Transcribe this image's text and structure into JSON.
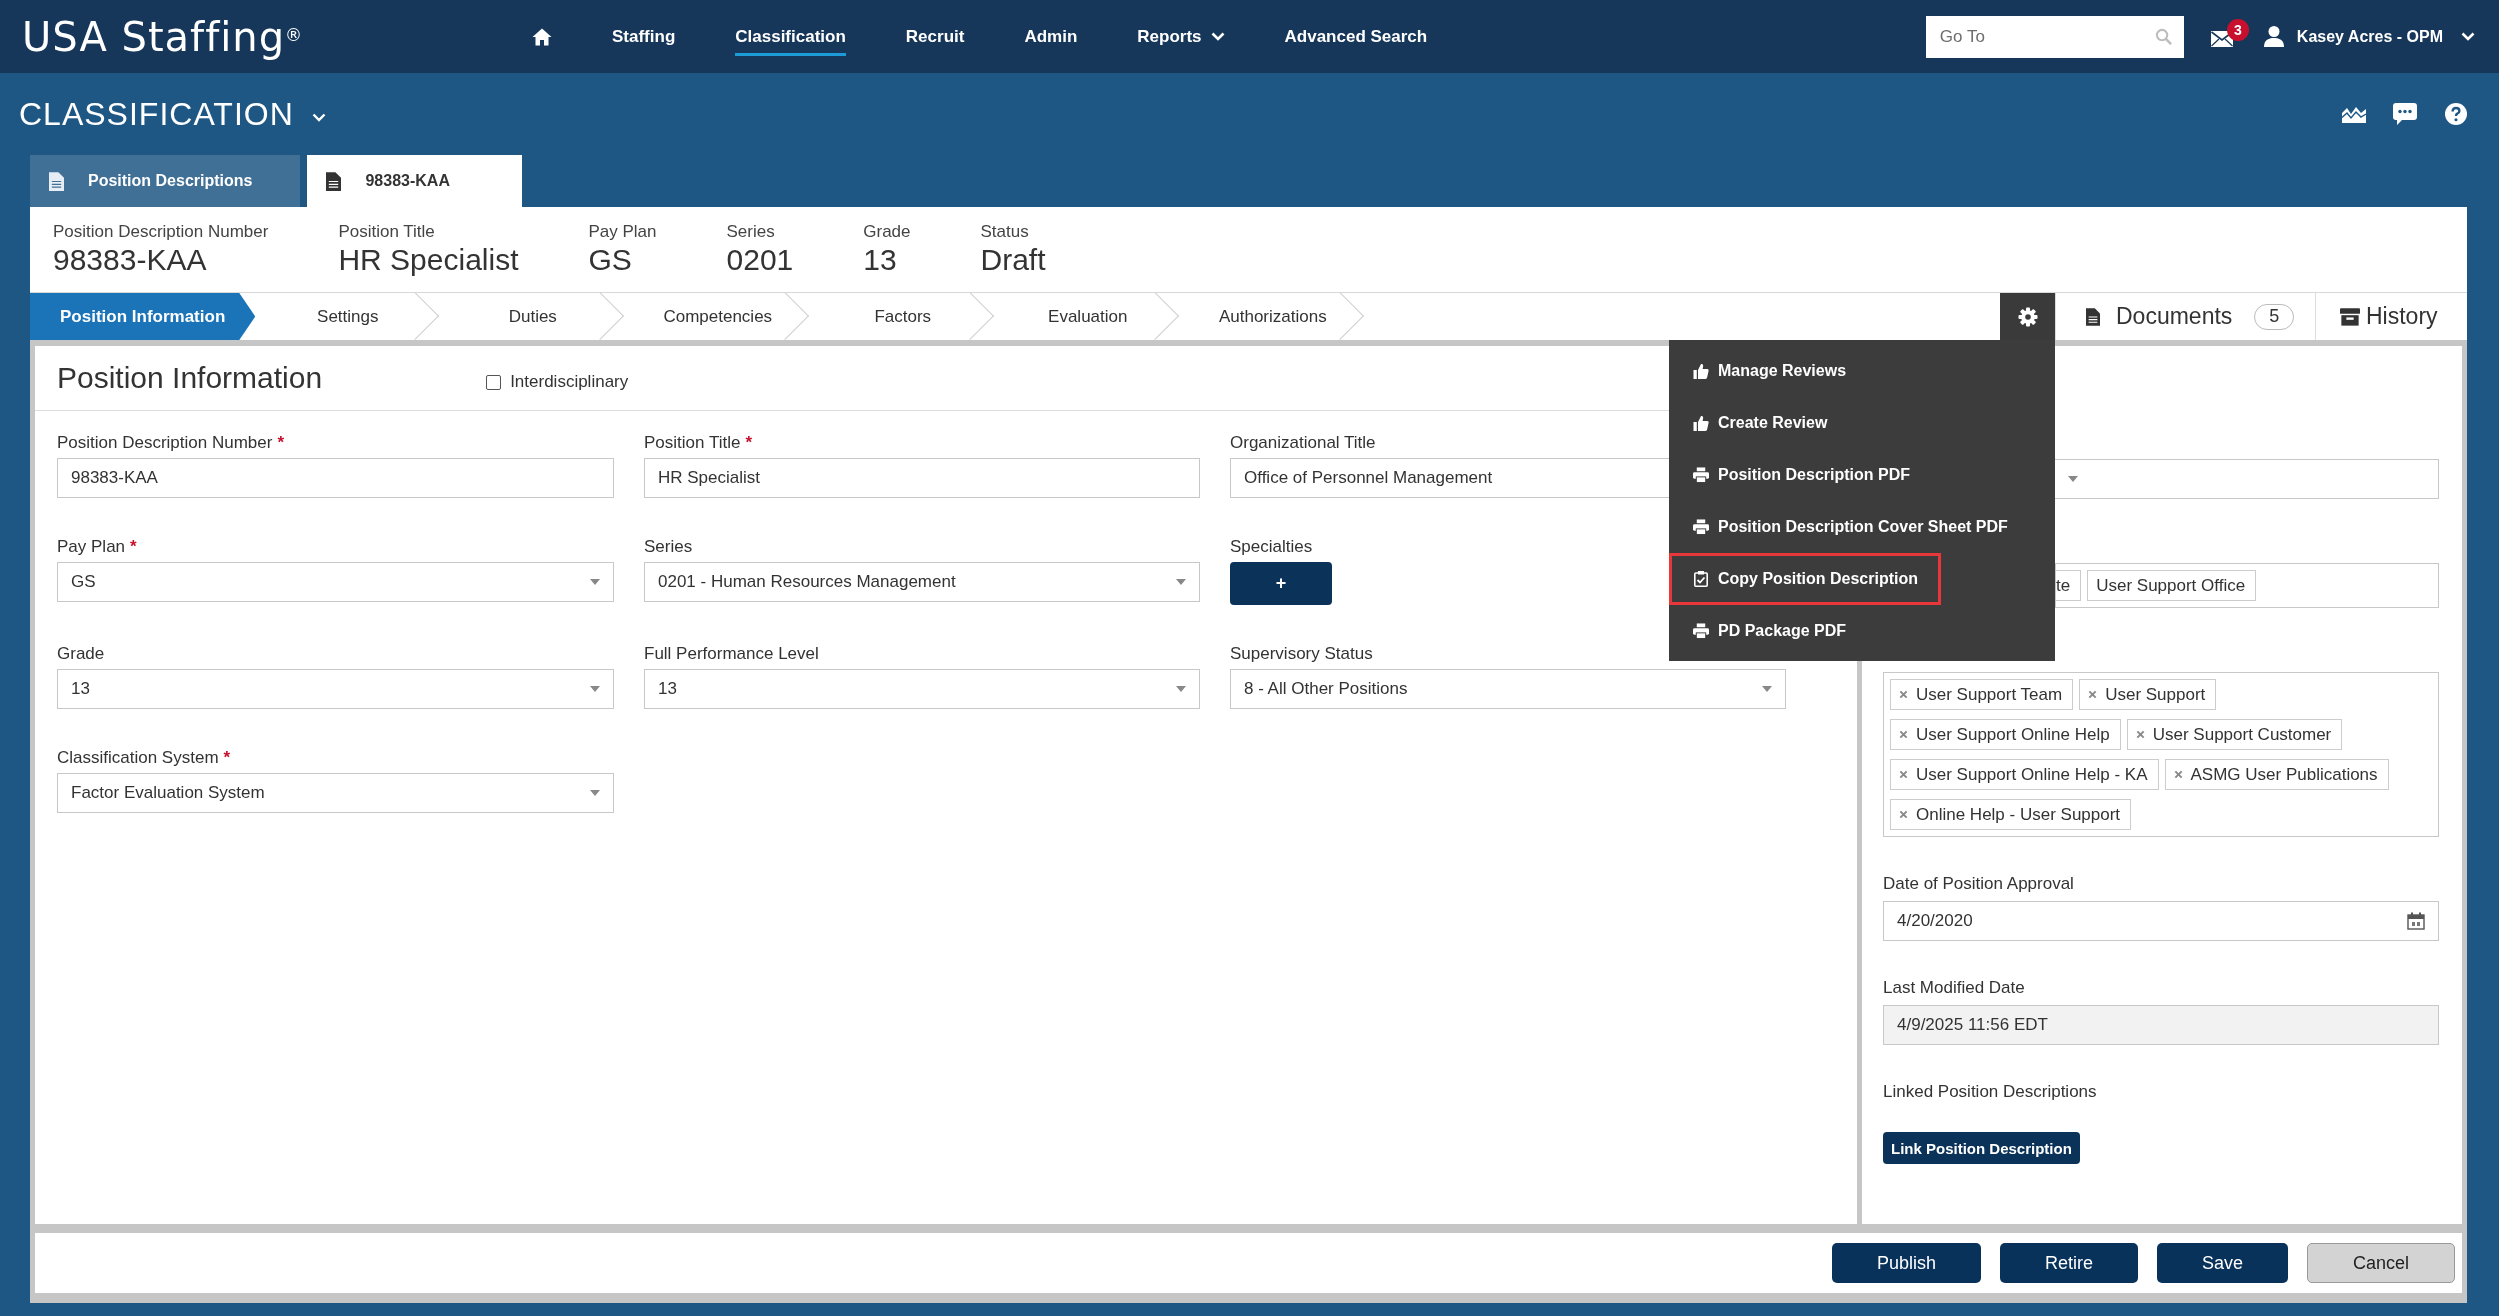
{
  "header": {
    "logo": "USA Staffing$^{®}$",
    "nav": [
      {
        "label": "Staffing",
        "selected": false,
        "dropdown": false
      },
      {
        "label": "Classification",
        "selected": true,
        "dropdown": false
      },
      {
        "label": "Recruit",
        "selected": false,
        "dropdown": false
      },
      {
        "label": "Admin",
        "selected": false,
        "dropdown": false
      },
      {
        "label": "Reports",
        "selected": false,
        "dropdown": true
      },
      {
        "label": "Advanced Search",
        "selected": false,
        "dropdown": false
      }
    ],
    "goto": {
      "placeholder": "Go To"
    },
    "messages": {
      "badge": "3"
    },
    "user": {
      "name": "Kasey Acres - OPM"
    }
  },
  "module": {
    "title": "CLASSIFICATION"
  },
  "tabs": [
    {
      "label": "Position Descriptions",
      "selected": false
    },
    {
      "label": "98383-KAA",
      "selected": true
    }
  ],
  "summary": [
    {
      "label": "Position Description Number",
      "value": "98383-KAA"
    },
    {
      "label": "Position Title",
      "value": "HR Specialist"
    },
    {
      "label": "Pay Plan",
      "value": "GS"
    },
    {
      "label": "Series",
      "value": "0201"
    },
    {
      "label": "Grade",
      "value": "13"
    },
    {
      "label": "Status",
      "value": "Draft"
    }
  ],
  "steps": [
    {
      "label": "Position Information",
      "selected": true
    },
    {
      "label": "Settings",
      "selected": false
    },
    {
      "label": "Duties",
      "selected": false
    },
    {
      "label": "Competencies",
      "selected": false
    },
    {
      "label": "Factors",
      "selected": false
    },
    {
      "label": "Evaluation",
      "selected": false
    },
    {
      "label": "Authorizations",
      "selected": false
    }
  ],
  "side_tabs": {
    "documents": {
      "label": "Documents",
      "count": "5"
    },
    "history": {
      "label": "History"
    }
  },
  "actions_menu": {
    "expanded": true,
    "items": [
      {
        "label": "Manage Reviews",
        "kind": "review",
        "highlighted": false
      },
      {
        "label": "Create Review",
        "kind": "review",
        "highlighted": false
      },
      {
        "label": "Position Description PDF",
        "kind": "print",
        "highlighted": false
      },
      {
        "label": "Position Description Cover Sheet PDF",
        "kind": "print",
        "highlighted": false
      },
      {
        "label": "Copy Position Description",
        "kind": "copy",
        "highlighted": true
      },
      {
        "label": "PD Package PDF",
        "kind": "print",
        "highlighted": false
      }
    ]
  },
  "section": {
    "title": "Position Information",
    "interdisciplinary": {
      "label": "Interdisciplinary",
      "checked": false
    }
  },
  "form": {
    "required_mark": "*",
    "fields": [
      {
        "label": "Position Description Number",
        "required": true,
        "kind": "text",
        "value": "98383-KAA",
        "covered": false
      },
      {
        "label": "Position Title",
        "required": true,
        "kind": "text",
        "value": "HR Specialist",
        "covered": false
      },
      {
        "label": "Organizational Title",
        "required": false,
        "kind": "text",
        "value": "Office of Personnel Management",
        "covered": true
      },
      {
        "label": "Pay Plan",
        "required": true,
        "kind": "select",
        "value": "GS",
        "covered": false
      },
      {
        "label": "Series",
        "required": false,
        "kind": "select",
        "value": "0201 - Human Resources Management",
        "covered": false
      },
      {
        "label": "Specialties",
        "required": false,
        "kind": "add",
        "button": "+",
        "covered": false
      },
      {
        "label": "Grade",
        "required": false,
        "kind": "select",
        "value": "13",
        "covered": false
      },
      {
        "label": "Full Performance Level",
        "required": false,
        "kind": "select",
        "value": "13",
        "covered": false
      },
      {
        "label": "Supervisory Status",
        "required": false,
        "kind": "select",
        "value": "8 - All Other Positions",
        "covered": false
      },
      {
        "label": "Classification System",
        "required": true,
        "kind": "select",
        "value": "Factor Evaluation System",
        "covered": false
      }
    ]
  },
  "details": {
    "items": [
      {
        "kind": "select",
        "covered": true
      },
      {
        "kind": "tags",
        "covered": true,
        "removable": false,
        "tags": [
          "te",
          "User Support Office"
        ]
      },
      {
        "kind": "tags",
        "covered": false,
        "removable": true,
        "tags": [
          "User Support Team",
          "User Support",
          "User Support Online Help",
          "User Support Customer",
          "User Support Online Help - KA",
          "ASMG User Publications",
          "Online Help - User Support"
        ]
      },
      {
        "kind": "date",
        "label": "Date of Position Approval",
        "value": "4/20/2020",
        "covered": false
      },
      {
        "kind": "readonly",
        "label": "Last Modified Date",
        "value": "4/9/2025 11:56 EDT",
        "covered": false
      },
      {
        "kind": "link",
        "label": "Linked Position Descriptions",
        "button": "Link Position Description",
        "covered": false
      }
    ]
  },
  "footer": {
    "buttons": [
      {
        "label": "Publish",
        "kind": "primary"
      },
      {
        "label": "Retire",
        "kind": "primary"
      },
      {
        "label": "Save",
        "kind": "primary"
      },
      {
        "label": "Cancel",
        "kind": "secondary"
      }
    ]
  }
}
